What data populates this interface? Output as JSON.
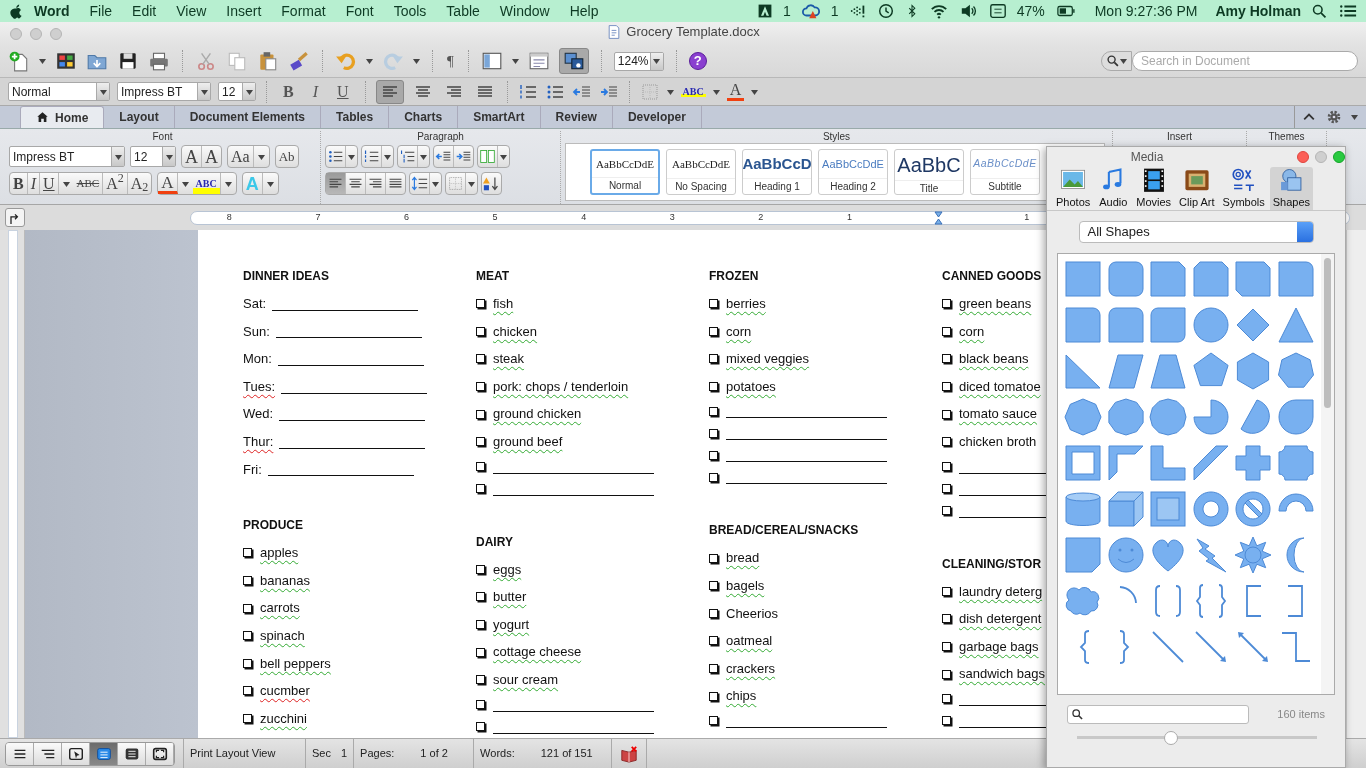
{
  "menubar": {
    "app": "Word",
    "items": [
      "File",
      "Edit",
      "View",
      "Insert",
      "Format",
      "Font",
      "Tools",
      "Table",
      "Window",
      "Help"
    ],
    "adobe_count": "1",
    "cloud_count": "1",
    "battery": "47%",
    "clock": "Mon 9:27:36 PM",
    "user": "Amy Holman"
  },
  "window": {
    "title": "Grocery Template.docx"
  },
  "toolbar": {
    "paragraph_mark": "¶",
    "zoom": "124%",
    "help": "?",
    "media_browser_on": true,
    "search_placeholder": "Search in Document"
  },
  "format_bar": {
    "style": "Normal",
    "font": "Impress BT",
    "size": "12",
    "text_buttons": [
      "B",
      "I",
      "U"
    ],
    "alignment": [
      {
        "selected": true
      },
      {
        "selected": false
      },
      {
        "selected": false
      },
      {
        "selected": false
      }
    ],
    "highlight": "ABC",
    "font_color": "A"
  },
  "ribbon": {
    "tabs": [
      {
        "label": "Home",
        "selected": true
      },
      {
        "label": "Layout",
        "selected": false
      },
      {
        "label": "Document Elements",
        "selected": false
      },
      {
        "label": "Tables",
        "selected": false
      },
      {
        "label": "Charts",
        "selected": false
      },
      {
        "label": "SmartArt",
        "selected": false
      },
      {
        "label": "Review",
        "selected": false
      },
      {
        "label": "Developer",
        "selected": false
      }
    ],
    "groups": [
      "Font",
      "Paragraph",
      "Styles",
      "Insert",
      "Themes"
    ],
    "font": "Impress BT",
    "size": "12",
    "grow": "A",
    "shrink": "A",
    "change_case": "Aa",
    "clear": "Ab",
    "text_buttons": [
      "B",
      "I",
      "U",
      "ABC",
      "A$^{2}$",
      "A$_{2}$"
    ],
    "font_color": "A",
    "highlight": "ABC",
    "text_effects": "A",
    "alignment": [
      {
        "selected": true
      },
      {
        "selected": false
      },
      {
        "selected": false
      },
      {
        "selected": false
      }
    ],
    "styles": [
      {
        "kind": "normal",
        "preview": "AaBbCcDdE",
        "label": "Normal",
        "selected": true
      },
      {
        "kind": "normal",
        "preview": "AaBbCcDdE",
        "label": "No Spacing",
        "selected": false
      },
      {
        "kind": "heading1",
        "preview": "AaBbCcD",
        "label": "Heading 1",
        "selected": false
      },
      {
        "kind": "heading2",
        "preview": "AaBbCcDdE",
        "label": "Heading 2",
        "selected": false
      },
      {
        "kind": "title",
        "preview": "AaBbC",
        "label": "Title",
        "selected": false
      },
      {
        "kind": "subtitle",
        "preview": "AaBbCcDdE",
        "label": "Subtitle",
        "selected": false
      }
    ]
  },
  "ruler": {
    "left_labels": [
      "8",
      "7",
      "6",
      "5",
      "4",
      "3",
      "2",
      "1"
    ],
    "right_labels": [
      "1"
    ]
  },
  "document": {
    "columns": [
      {
        "sections": [
          {
            "heading": "DINNER IDEAS",
            "items": [
              {
                "kind": "day",
                "text": "Sat:",
                "grammar_flag": false,
                "spelling_flag": false
              },
              {
                "kind": "day",
                "text": "Sun:",
                "grammar_flag": false,
                "spelling_flag": false
              },
              {
                "kind": "day",
                "text": "Mon:",
                "grammar_flag": false,
                "spelling_flag": false
              },
              {
                "kind": "day",
                "text": "Tues:",
                "grammar_flag": false,
                "spelling_flag": true
              },
              {
                "kind": "day",
                "text": "Wed:",
                "grammar_flag": false,
                "spelling_flag": false
              },
              {
                "kind": "day",
                "text": "Thur:",
                "grammar_flag": false,
                "spelling_flag": true
              },
              {
                "kind": "day",
                "text": "Fri:",
                "grammar_flag": false,
                "spelling_flag": false
              }
            ]
          },
          {
            "heading": "PRODUCE",
            "items": [
              {
                "kind": "check",
                "text": "apples",
                "grammar_flag": true,
                "spelling_flag": false
              },
              {
                "kind": "check",
                "text": "bananas",
                "grammar_flag": true,
                "spelling_flag": false
              },
              {
                "kind": "check",
                "text": "carrots",
                "grammar_flag": true,
                "spelling_flag": false
              },
              {
                "kind": "check",
                "text": "spinach",
                "grammar_flag": true,
                "spelling_flag": false
              },
              {
                "kind": "check",
                "text": "bell peppers",
                "grammar_flag": true,
                "spelling_flag": false
              },
              {
                "kind": "check",
                "text": "cucmber",
                "grammar_flag": false,
                "spelling_flag": true
              },
              {
                "kind": "check",
                "text": "zucchini",
                "grammar_flag": true,
                "spelling_flag": false
              }
            ]
          }
        ]
      },
      {
        "sections": [
          {
            "heading": "MEAT",
            "items": [
              {
                "kind": "check",
                "text": "fish",
                "grammar_flag": true,
                "spelling_flag": false
              },
              {
                "kind": "check",
                "text": "chicken",
                "grammar_flag": true,
                "spelling_flag": false
              },
              {
                "kind": "check",
                "text": "steak",
                "grammar_flag": true,
                "spelling_flag": false
              },
              {
                "kind": "check",
                "text": "pork: chops / tenderloin",
                "grammar_flag": true,
                "spelling_flag": false
              },
              {
                "kind": "check",
                "text": "ground chicken",
                "grammar_flag": true,
                "spelling_flag": false
              },
              {
                "kind": "check",
                "text": "ground beef",
                "grammar_flag": true,
                "spelling_flag": false
              },
              {
                "kind": "blank"
              },
              {
                "kind": "blank"
              }
            ]
          },
          {
            "heading": "DAIRY",
            "items": [
              {
                "kind": "check",
                "text": "eggs",
                "grammar_flag": true,
                "spelling_flag": false
              },
              {
                "kind": "check",
                "text": "butter",
                "grammar_flag": true,
                "spelling_flag": false
              },
              {
                "kind": "check",
                "text": "yogurt",
                "grammar_flag": true,
                "spelling_flag": false
              },
              {
                "kind": "check",
                "text": "cottage cheese",
                "grammar_flag": true,
                "spelling_flag": false
              },
              {
                "kind": "check",
                "text": "sour cream",
                "grammar_flag": true,
                "spelling_flag": false
              },
              {
                "kind": "blank"
              },
              {
                "kind": "blank"
              }
            ]
          }
        ]
      },
      {
        "sections": [
          {
            "heading": "FROZEN",
            "items": [
              {
                "kind": "check",
                "text": "berries",
                "grammar_flag": true,
                "spelling_flag": false
              },
              {
                "kind": "check",
                "text": "corn",
                "grammar_flag": true,
                "spelling_flag": false
              },
              {
                "kind": "check",
                "text": "mixed veggies",
                "grammar_flag": true,
                "spelling_flag": false
              },
              {
                "kind": "check",
                "text": "potatoes",
                "grammar_flag": true,
                "spelling_flag": false
              },
              {
                "kind": "blank"
              },
              {
                "kind": "blank"
              },
              {
                "kind": "blank"
              },
              {
                "kind": "blank"
              }
            ]
          },
          {
            "heading": "BREAD/CEREAL/SNACKS",
            "items": [
              {
                "kind": "check",
                "text": "bread",
                "grammar_flag": true,
                "spelling_flag": false
              },
              {
                "kind": "check",
                "text": "bagels",
                "grammar_flag": true,
                "spelling_flag": false
              },
              {
                "kind": "check",
                "text": "Cheerios",
                "grammar_flag": false,
                "spelling_flag": false
              },
              {
                "kind": "check",
                "text": "oatmeal",
                "grammar_flag": true,
                "spelling_flag": false
              },
              {
                "kind": "check",
                "text": "crackers",
                "grammar_flag": true,
                "spelling_flag": false
              },
              {
                "kind": "check",
                "text": "chips",
                "grammar_flag": true,
                "spelling_flag": false
              },
              {
                "kind": "blank"
              }
            ]
          }
        ]
      },
      {
        "sections": [
          {
            "heading": "CANNED GOODS",
            "items": [
              {
                "kind": "check",
                "text": "green beans",
                "grammar_flag": true,
                "spelling_flag": false
              },
              {
                "kind": "check",
                "text": "corn",
                "grammar_flag": true,
                "spelling_flag": false
              },
              {
                "kind": "check",
                "text": "black beans",
                "grammar_flag": true,
                "spelling_flag": false
              },
              {
                "kind": "check",
                "text": "diced tomatoe",
                "grammar_flag": true,
                "spelling_flag": false
              },
              {
                "kind": "check",
                "text": "tomato sauce",
                "grammar_flag": true,
                "spelling_flag": false
              },
              {
                "kind": "check",
                "text": "chicken broth",
                "grammar_flag": false,
                "spelling_flag": false
              },
              {
                "kind": "blank"
              },
              {
                "kind": "blank"
              },
              {
                "kind": "blank"
              }
            ]
          },
          {
            "heading": "CLEANING/STOR",
            "items": [
              {
                "kind": "check",
                "text": "laundry deterg",
                "grammar_flag": true,
                "spelling_flag": false
              },
              {
                "kind": "check",
                "text": "dish detergent",
                "grammar_flag": true,
                "spelling_flag": false
              },
              {
                "kind": "check",
                "text": "garbage bags",
                "grammar_flag": true,
                "spelling_flag": false
              },
              {
                "kind": "check",
                "text": "sandwich bags",
                "grammar_flag": true,
                "spelling_flag": false
              },
              {
                "kind": "blank"
              },
              {
                "kind": "blank"
              }
            ]
          }
        ]
      }
    ]
  },
  "media": {
    "title": "Media",
    "tabs": [
      {
        "kind": "photos",
        "label": "Photos",
        "selected": false
      },
      {
        "kind": "audio",
        "label": "Audio",
        "selected": false
      },
      {
        "kind": "movies",
        "label": "Movies",
        "selected": false
      },
      {
        "kind": "clipart",
        "label": "Clip Art",
        "selected": false
      },
      {
        "kind": "symbols",
        "label": "Symbols",
        "selected": false
      },
      {
        "kind": "shapes",
        "label": "Shapes",
        "selected": true
      }
    ],
    "category": "All Shapes",
    "count": "160 items",
    "size_slider": {
      "level": 0.39
    }
  },
  "status_bar": {
    "views": [
      {
        "selected": false
      },
      {
        "selected": false
      },
      {
        "selected": false
      },
      {
        "selected": true
      },
      {
        "selected": false
      },
      {
        "selected": false
      }
    ],
    "view_name": "Print Layout View",
    "section_label": "Sec",
    "section": "1",
    "pages_label": "Pages:",
    "pages": "1 of 2",
    "words_label": "Words:",
    "words": "121 of 151"
  }
}
